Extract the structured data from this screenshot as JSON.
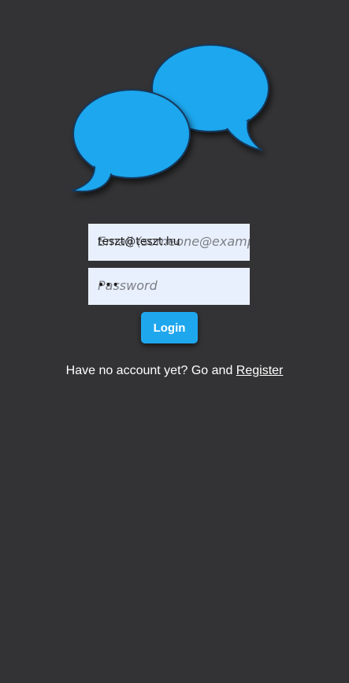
{
  "logo": {
    "icon": "chat-bubbles-icon",
    "colors": {
      "bubble": "#1fa7ee",
      "outline": "#15395c"
    }
  },
  "login_form": {
    "email": {
      "placeholder": "Email (someone@example",
      "value": "teszt@teszt.hu"
    },
    "password": {
      "placeholder": "Password",
      "masked_value": "•••"
    },
    "login_label": "Login"
  },
  "footer": {
    "prompt": "Have no account yet? Go and ",
    "register_label": "Register"
  },
  "colors": {
    "background": "#333335",
    "accent": "#1fa7ee",
    "input_bg": "#e9f0fd"
  }
}
